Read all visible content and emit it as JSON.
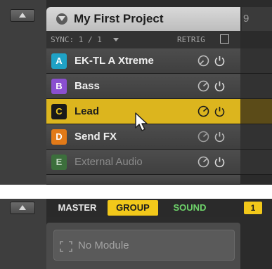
{
  "project": {
    "title": "My First Project",
    "column_number": "9"
  },
  "sync": {
    "label": "SYNC: 1 / 1",
    "retrig_label": "RETRIG",
    "retrig_checked": false
  },
  "groups": [
    {
      "letter": "A",
      "name": "EK-TL A Xtreme",
      "color": "#1fa2c6",
      "selected": false,
      "dim": false
    },
    {
      "letter": "B",
      "name": "Bass",
      "color": "#8a4fd0",
      "selected": false,
      "dim": false
    },
    {
      "letter": "C",
      "name": "Lead",
      "color": "#1a1a1a",
      "selected": true,
      "dim": false
    },
    {
      "letter": "D",
      "name": "Send FX",
      "color": "#e27a18",
      "selected": false,
      "dim": false
    },
    {
      "letter": "E",
      "name": "External Audio",
      "color": "#3c6f3c",
      "selected": false,
      "dim": true
    }
  ],
  "bottom": {
    "tabs": {
      "master": "MASTER",
      "group": "GROUP",
      "sound": "SOUND"
    },
    "active_tab": "GROUP",
    "slot_number": "1",
    "module_label": "No Module"
  },
  "colors": {
    "selected_yellow": "#dcb51e",
    "tab_yellow": "#f2c81a",
    "sound_green": "#6ed36a"
  }
}
